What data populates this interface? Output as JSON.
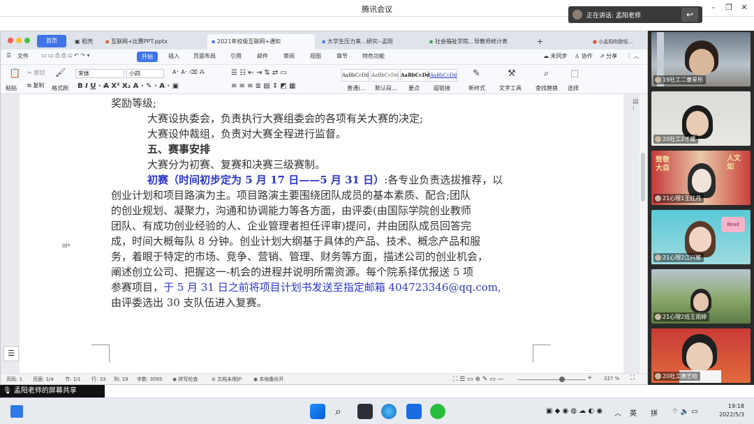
{
  "meeting": {
    "title": "腾讯会议",
    "speaking_label": "正在讲话: 孟阳老师",
    "share_label": "孟阳老师的屏幕共享"
  },
  "wps": {
    "home_tab": "首页",
    "tabs": [
      {
        "label": "稻壳",
        "active": false
      },
      {
        "label": "互联网+比赛PPT.pptx",
        "active": false
      },
      {
        "label": "2021年校级互联网+通知",
        "active": true
      },
      {
        "label": "大学生压力来…研究--孟阳",
        "active": false
      },
      {
        "label": "社会福祉学院…导教师统计表",
        "active": false
      }
    ],
    "new_tab": "+",
    "user": "小孟阳你欧恒…",
    "menus": [
      "文件",
      "开始",
      "插入",
      "页面布局",
      "引用",
      "邮件",
      "审阅",
      "视图",
      "章节",
      "特色功能"
    ],
    "menu_right": [
      "未同步",
      "协作",
      "分享"
    ],
    "ribbon": {
      "paste": "粘贴",
      "cut": "剪切",
      "copy": "复制",
      "format_painter": "格式刷",
      "font": "宋体",
      "size": "小四",
      "styles": [
        {
          "sample": "AaBbCcDd",
          "label": "普通(…"
        },
        {
          "sample": "AaBbCcDd",
          "label": "默认段…"
        },
        {
          "sample": "AaBbCcDd",
          "label": "要点"
        },
        {
          "sample": "AaBbCcDd",
          "label": "超链接"
        }
      ],
      "new_style": "新样式",
      "text_tools": "文字工具",
      "find_replace": "查找替换",
      "select": "选择"
    },
    "document": {
      "line1": "奖励等级;",
      "line2": "大赛设执委会，负责执行大赛组委会的各项有关大赛的决定;",
      "line3": "大赛设仲裁组，负责对大赛全程进行监督。",
      "heading5": "五、赛事安排",
      "line4": "大赛分为初赛、复赛和决赛三级赛制。",
      "para_blue_lead": "初赛（时间初步定为 5 月 17 日——5 月 31 日）",
      "para_lines": [
        ":各专业负责选拔推荐，以",
        "创业计划和项目路演为主。项目路演主要围绕团队成员的基本素质、配合;团队",
        "的创业规划、凝聚力，沟通和协调能力等各方面，由评委(由国际学院创业教师",
        "团队、有成功创业经验的人、企业管理者担任评审)提问，并由团队成员回答完",
        "成，时间大概每队 8 分钟。创业计划大纲基于具体的产品、技术、概念产品和服",
        "务，着眼于特定的市场、竞争、营销、管理、财务等方面，描述公司的创业机会，",
        "阐述创立公司、把握这一-机会的进程并说明所需资源。每个院系择优报送 5 项",
        "参赛项目，"
      ],
      "blue_tail": "于 5 月 31 日之前将项目计划书发送至指定邮箱 404723346@qq.com,",
      "last_line": "由评委选出 30 支队伍进入复赛。"
    },
    "status": {
      "page_no": "页码: 1",
      "pages": "页面: 1/4",
      "section": "节: 1/1",
      "row": "行: 33",
      "col": "列: 19",
      "words": "字数: 3095",
      "spellcheck": "拼写检查",
      "doc_protect": "文档未保护",
      "backup": "本地备份开",
      "zoom": "227 %"
    }
  },
  "participants": [
    {
      "name": "19社工二曹星彤"
    },
    {
      "name": "20社工2才媛"
    },
    {
      "name": "21心理1王红月"
    },
    {
      "name": "21心理2江兴雅"
    },
    {
      "name": "21心理2班王雨婷"
    },
    {
      "name": "20社工唐艺晗"
    }
  ],
  "tile_texts": {
    "t3_left": "致敬大自",
    "t3_right": "人文如",
    "t4_badge": "Read"
  },
  "taskbar": {
    "ime_en": "英",
    "ime_pin": "拼",
    "time": "19:18",
    "date": "2022/5/3"
  },
  "colors": {
    "accent": "#3f74e8",
    "doc_blue": "#2b35c9"
  }
}
